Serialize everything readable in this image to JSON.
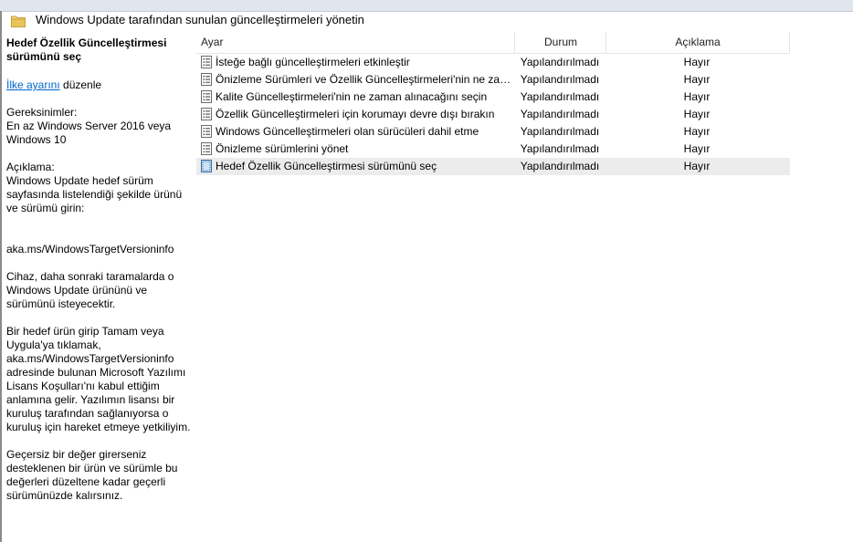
{
  "window": {
    "title": "Windows Update tarafından sunulan güncelleştirmeleri yönetin"
  },
  "description": {
    "title": "Hedef Özellik Güncelleştirmesi sürümünü seç",
    "edit_link": "İlke ayarını",
    "edit_suffix": " düzenle",
    "requirements_label": "Gereksinimler:",
    "requirements_text": "En az Windows Server 2016 veya Windows 10",
    "desc_label": "Açıklama:",
    "desc_p1": "Windows Update hedef sürüm sayfasında listelendiği şekilde ürünü ve sürümü girin:",
    "desc_url": "aka.ms/WindowsTargetVersioninfo",
    "desc_p2": "Cihaz, daha sonraki taramalarda o Windows Update ürününü ve sürümünü isteyecektir.",
    "desc_p3": "Bir hedef ürün girip Tamam veya Uygula'ya tıklamak, aka.ms/WindowsTargetVersioninfo adresinde bulunan Microsoft Yazılımı Lisans Koşulları'nı kabul ettiğim anlamına gelir. Yazılımın lisansı bir kuruluş tarafından sağlanıyorsa o kuruluş için hareket etmeye yetkiliyim.",
    "desc_p4": "Geçersiz bir değer girerseniz desteklenen bir ürün ve sürümle bu değerleri düzeltene kadar geçerli sürümünüzde kalırsınız."
  },
  "table": {
    "columns": {
      "setting": "Ayar",
      "state": "Durum",
      "comment": "Açıklama"
    },
    "rows": [
      {
        "name": "İsteğe bağlı güncelleştirmeleri etkinleştir",
        "status": "Yapılandırılmadı",
        "comment": "Hayır",
        "icon": "policy-setting-icon"
      },
      {
        "name": "Önizleme Sürümleri ve Özellik Güncelleştirmeleri'nin ne zaman alınacağını seçin",
        "status": "Yapılandırılmadı",
        "comment": "Hayır",
        "icon": "policy-setting-icon"
      },
      {
        "name": "Kalite Güncelleştirmeleri'nin ne zaman alınacağını seçin",
        "status": "Yapılandırılmadı",
        "comment": "Hayır",
        "icon": "policy-setting-icon"
      },
      {
        "name": "Özellik Güncelleştirmeleri için korumayı devre dışı bırakın",
        "status": "Yapılandırılmadı",
        "comment": "Hayır",
        "icon": "policy-setting-icon"
      },
      {
        "name": "Windows Güncelleştirmeleri olan sürücüleri dahil etme",
        "status": "Yapılandırılmadı",
        "comment": "Hayır",
        "icon": "policy-setting-icon"
      },
      {
        "name": "Önizleme sürümlerini yönet",
        "status": "Yapılandırılmadı",
        "comment": "Hayır",
        "icon": "policy-setting-icon"
      },
      {
        "name": "Hedef Özellik Güncelleştirmesi sürümünü seç",
        "status": "Yapılandırılmadı",
        "comment": "Hayır",
        "icon": "policy-setting-selected-icon",
        "selected": true
      }
    ]
  },
  "colors": {
    "link": "#0066cc",
    "selected_row": "#ececec",
    "folder": "#e8c45a"
  }
}
